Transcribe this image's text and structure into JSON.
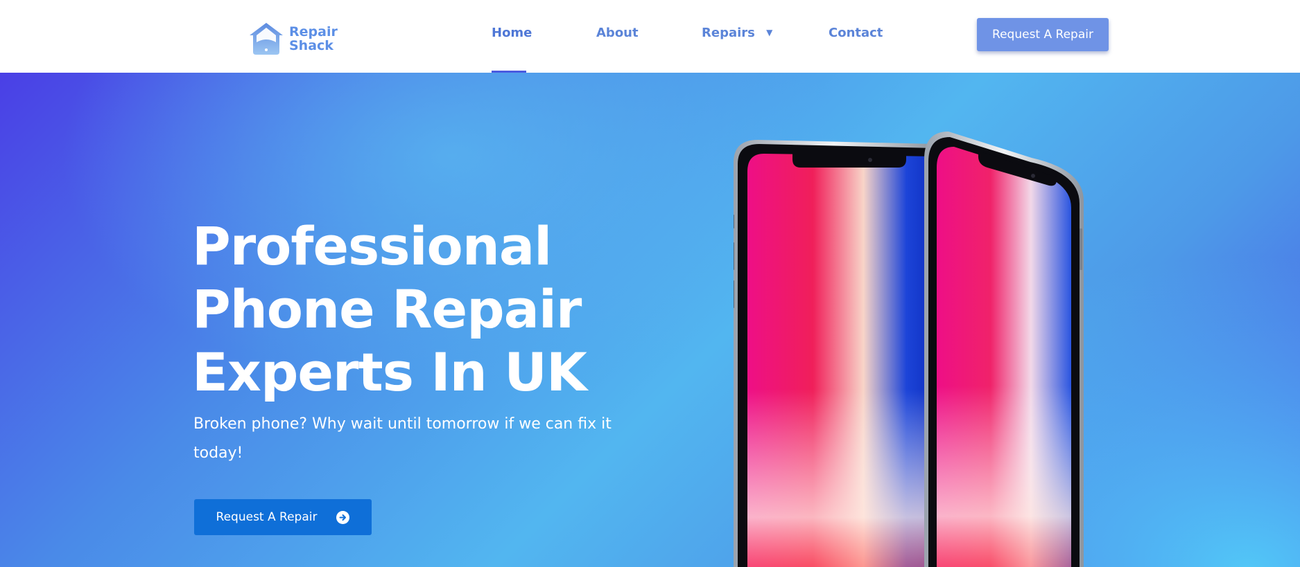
{
  "brand": {
    "name_line1": "Repair",
    "name_line2": "Shack",
    "logo_icon": "house-phone-icon",
    "color": "#5c8fe6"
  },
  "nav": {
    "items": [
      {
        "label": "Home",
        "active": true
      },
      {
        "label": "About"
      },
      {
        "label": "Repairs",
        "icon": "caret-down-icon",
        "caret": "▼"
      },
      {
        "label": "Contact"
      }
    ],
    "cta_label": "Request A Repair"
  },
  "hero": {
    "title_lines": [
      "Professional",
      "Phone Repair",
      "Experts In UK"
    ],
    "subtitle": "Broken phone? Why wait until tomorrow if we can fix it today!",
    "cta_label": "Request A Repair",
    "cta_icon": "arrow-right-circle-icon",
    "image": "two-smartphones-image"
  },
  "colors": {
    "accent": "#4a5ae0",
    "hero_gradient_start": "#4a3fe6",
    "hero_gradient_mid": "#52b6f0",
    "hero_cta": "#0f6fd8",
    "header_cta": "#6f93e6"
  }
}
